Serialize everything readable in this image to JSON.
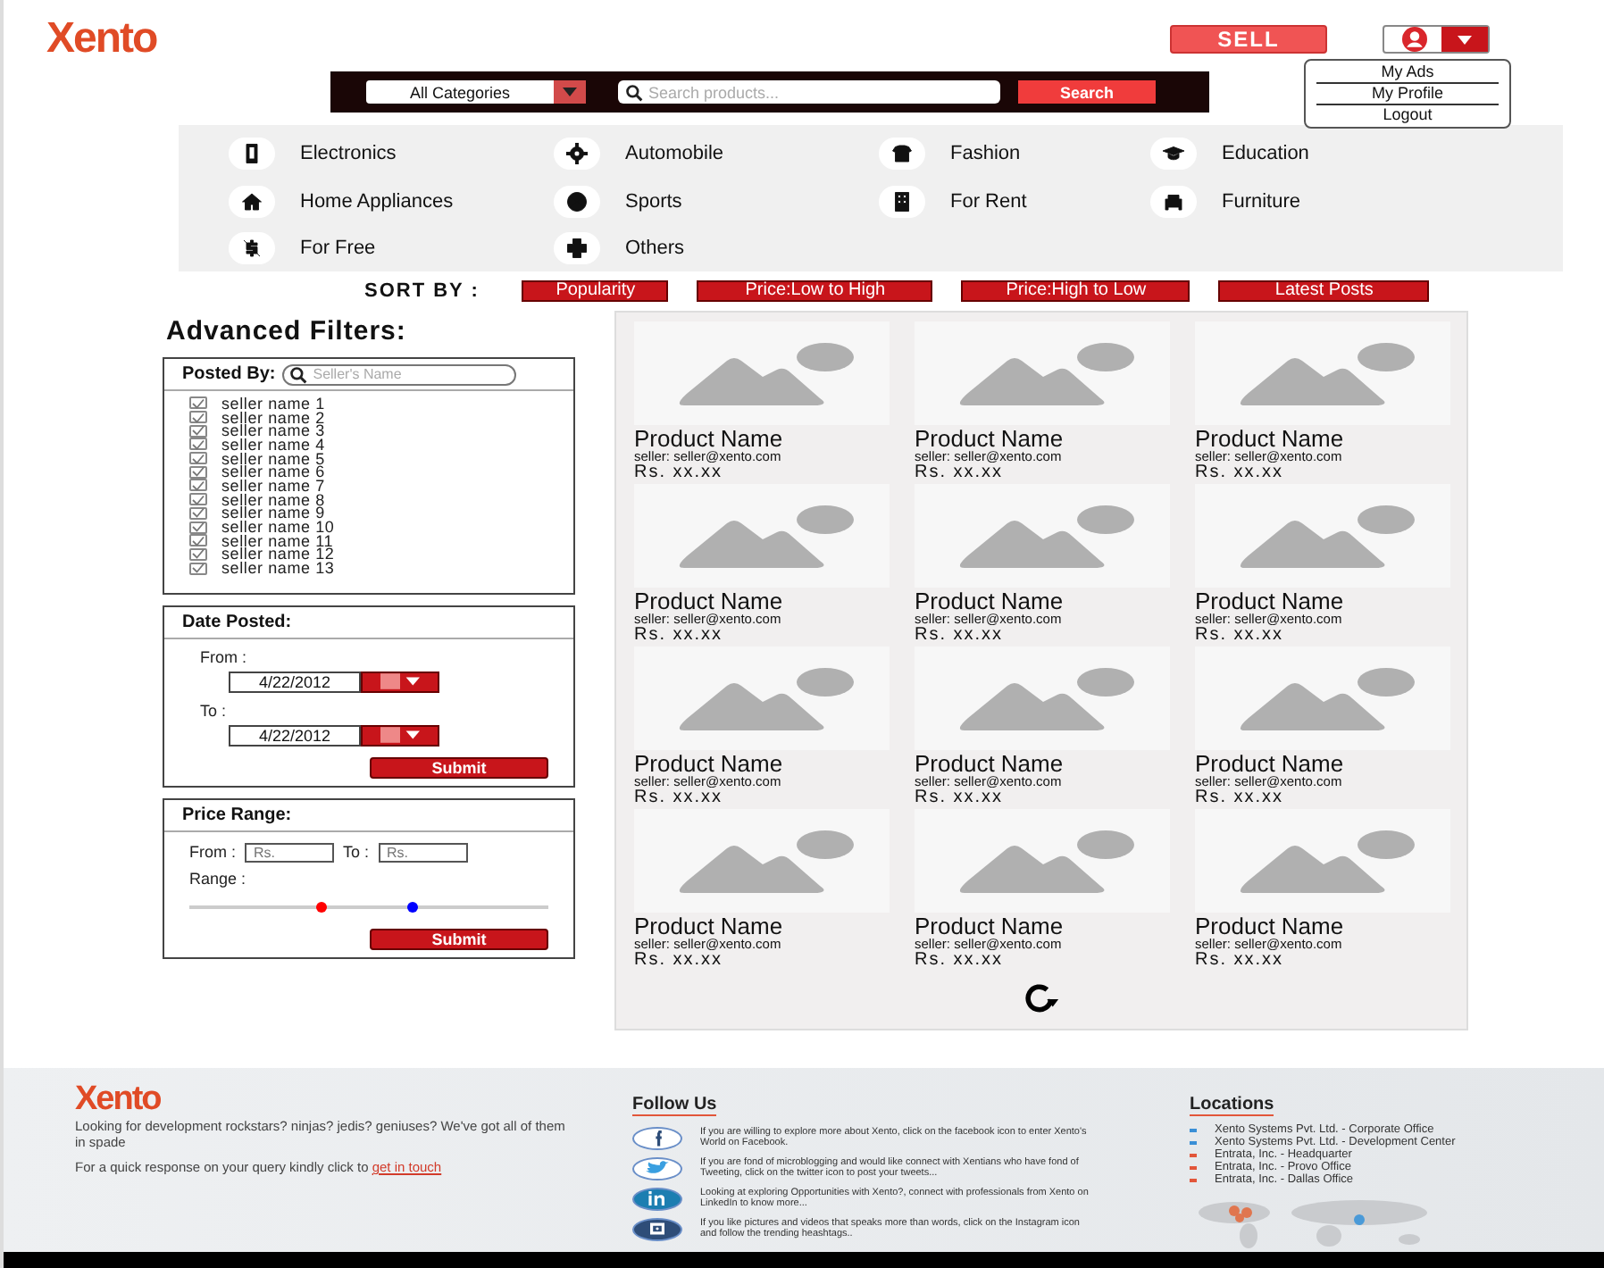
{
  "header": {
    "logo": "Xento",
    "sell_button": "SELL",
    "user_menu": {
      "expanded": true,
      "items": [
        "My Ads",
        "My Profile",
        "Logout"
      ]
    }
  },
  "search_bar": {
    "category": "All Categories",
    "placeholder": "Search products...",
    "button": "Search"
  },
  "categories": [
    {
      "kind": "phone",
      "label": "Electronics"
    },
    {
      "kind": "gear",
      "label": "Automobile"
    },
    {
      "kind": "shirt",
      "label": "Fashion"
    },
    {
      "kind": "cap",
      "label": "Education"
    },
    {
      "kind": "home",
      "label": "Home Appliances"
    },
    {
      "kind": "ball",
      "label": "Sports"
    },
    {
      "kind": "building",
      "label": "For Rent"
    },
    {
      "kind": "sofa",
      "label": "Furniture"
    },
    {
      "kind": "nodollar",
      "label": "For Free"
    },
    {
      "kind": "plus",
      "label": "Others"
    }
  ],
  "sort": {
    "label": "SORT BY :",
    "options": [
      "Popularity",
      "Price:Low to High",
      "Price:High to Low",
      "Latest Posts"
    ]
  },
  "filters": {
    "title": "Advanced Filters:",
    "posted_by": {
      "title": "Posted By:",
      "placeholder": "Seller's Name",
      "sellers": [
        {
          "name": "seller name 1",
          "checked": true
        },
        {
          "name": "seller name 2",
          "checked": true
        },
        {
          "name": "seller name 3",
          "checked": true
        },
        {
          "name": "seller name 4",
          "checked": true
        },
        {
          "name": "seller name 5",
          "checked": true
        },
        {
          "name": "seller name 6",
          "checked": true
        },
        {
          "name": "seller name 7",
          "checked": true
        },
        {
          "name": "seller name 8",
          "checked": true
        },
        {
          "name": "seller name 9",
          "checked": true
        },
        {
          "name": "seller name 10",
          "checked": true
        },
        {
          "name": "seller name 11",
          "checked": true
        },
        {
          "name": "seller name 12",
          "checked": true
        },
        {
          "name": "seller name 13",
          "checked": true
        }
      ]
    },
    "date_posted": {
      "title": "Date Posted:",
      "from_label": "From :",
      "from_value": "4/22/2012",
      "to_label": "To :",
      "to_value": "4/22/2012",
      "submit": "Submit"
    },
    "price_range": {
      "title": "Price Range:",
      "from_label": "From :",
      "from_placeholder": "Rs.",
      "to_label": "To :",
      "to_placeholder": "Rs.",
      "range_label": "Range :",
      "thumbs": [
        {
          "level": 0.37,
          "color": "#ff0000"
        },
        {
          "level": 0.62,
          "color": "#0000ff"
        }
      ],
      "submit": "Submit"
    }
  },
  "products": [
    {
      "name": "Product Name",
      "seller": "seller: seller@xento.com",
      "price": "Rs. xx.xx"
    },
    {
      "name": "Product Name",
      "seller": "seller: seller@xento.com",
      "price": "Rs. xx.xx"
    },
    {
      "name": "Product Name",
      "seller": "seller: seller@xento.com",
      "price": "Rs. xx.xx"
    },
    {
      "name": "Product Name",
      "seller": "seller: seller@xento.com",
      "price": "Rs. xx.xx"
    },
    {
      "name": "Product Name",
      "seller": "seller: seller@xento.com",
      "price": "Rs. xx.xx"
    },
    {
      "name": "Product Name",
      "seller": "seller: seller@xento.com",
      "price": "Rs. xx.xx"
    },
    {
      "name": "Product Name",
      "seller": "seller: seller@xento.com",
      "price": "Rs. xx.xx"
    },
    {
      "name": "Product Name",
      "seller": "seller: seller@xento.com",
      "price": "Rs. xx.xx"
    },
    {
      "name": "Product Name",
      "seller": "seller: seller@xento.com",
      "price": "Rs. xx.xx"
    },
    {
      "name": "Product Name",
      "seller": "seller: seller@xento.com",
      "price": "Rs. xx.xx"
    },
    {
      "name": "Product Name",
      "seller": "seller: seller@xento.com",
      "price": "Rs. xx.xx"
    },
    {
      "name": "Product Name",
      "seller": "seller: seller@xento.com",
      "price": "Rs. xx.xx"
    }
  ],
  "footer": {
    "logo": "Xento",
    "tagline": "Looking for development rockstars? ninjas? jedis? geniuses? We've got all of them in spade",
    "contact_text": "For a quick response on your query kindly click to",
    "contact_link": "get in touch",
    "follow_title": "Follow Us",
    "social": [
      {
        "kind": "facebook",
        "text": "If you are willing to explore more about Xento, click on the facebook icon to enter Xento's World on Facebook."
      },
      {
        "kind": "twitter",
        "text": "If you are fond of microblogging and would like connect with Xentians who have fond of Tweeting, click on the twitter icon to post your tweets..."
      },
      {
        "kind": "linkedin",
        "text": "Looking at exploring Opportunities with Xento?, connect with professionals from Xento on LinkedIn to know more..."
      },
      {
        "kind": "instagram",
        "text": "If you like pictures and videos that speaks more than words, click on the Instagram icon and follow the trending heashtags.."
      }
    ],
    "locations_title": "Locations",
    "locations": [
      {
        "name": "Xento Systems Pvt. Ltd. - Corporate Office",
        "color": "#3a8fd6"
      },
      {
        "name": "Xento Systems Pvt. Ltd. - Development Center",
        "color": "#3a8fd6"
      },
      {
        "name": "Entrata, Inc. - Headquarter",
        "color": "#e2563a"
      },
      {
        "name": "Entrata, Inc. - Provo Office",
        "color": "#e2563a"
      },
      {
        "name": "Entrata, Inc. - Dallas Office",
        "color": "#e2563a"
      }
    ]
  }
}
